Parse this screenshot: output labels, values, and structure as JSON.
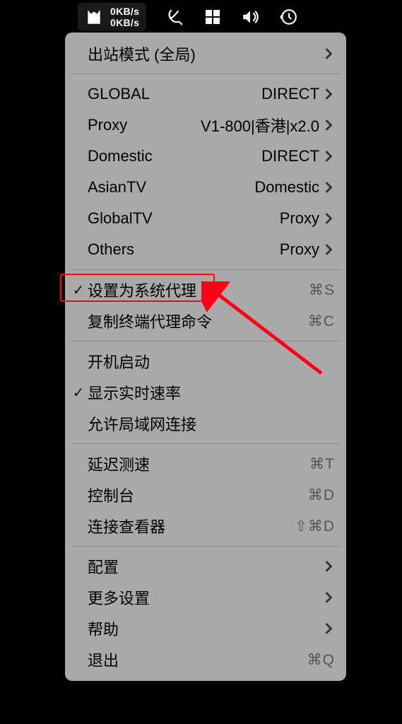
{
  "menubar": {
    "speed_up": "0KB/s",
    "speed_down": "0KB/s"
  },
  "menu": {
    "outbound_mode": "出站模式 (全局)",
    "rules": [
      {
        "name": "GLOBAL",
        "value": "DIRECT"
      },
      {
        "name": "Proxy",
        "value": "V1-800|香港|x2.0"
      },
      {
        "name": "Domestic",
        "value": "DIRECT"
      },
      {
        "name": "AsianTV",
        "value": "Domestic"
      },
      {
        "name": "GlobalTV",
        "value": "Proxy"
      },
      {
        "name": "Others",
        "value": "Proxy"
      }
    ],
    "set_system_proxy": {
      "label": "设置为系统代理",
      "shortcut": "⌘S",
      "checked": true
    },
    "copy_terminal_cmd": {
      "label": "复制终端代理命令",
      "shortcut": "⌘C"
    },
    "launch_on_login": {
      "label": "开机启动"
    },
    "show_realtime": {
      "label": "显示实时速率",
      "checked": true
    },
    "allow_lan": {
      "label": "允许局域网连接"
    },
    "latency_test": {
      "label": "延迟测速",
      "shortcut": "⌘T"
    },
    "console": {
      "label": "控制台",
      "shortcut": "⌘D"
    },
    "conn_viewer": {
      "label": "连接查看器",
      "shortcut": "⇧⌘D"
    },
    "config": {
      "label": "配置"
    },
    "more_settings": {
      "label": "更多设置"
    },
    "help": {
      "label": "帮助"
    },
    "quit": {
      "label": "退出",
      "shortcut": "⌘Q"
    }
  }
}
